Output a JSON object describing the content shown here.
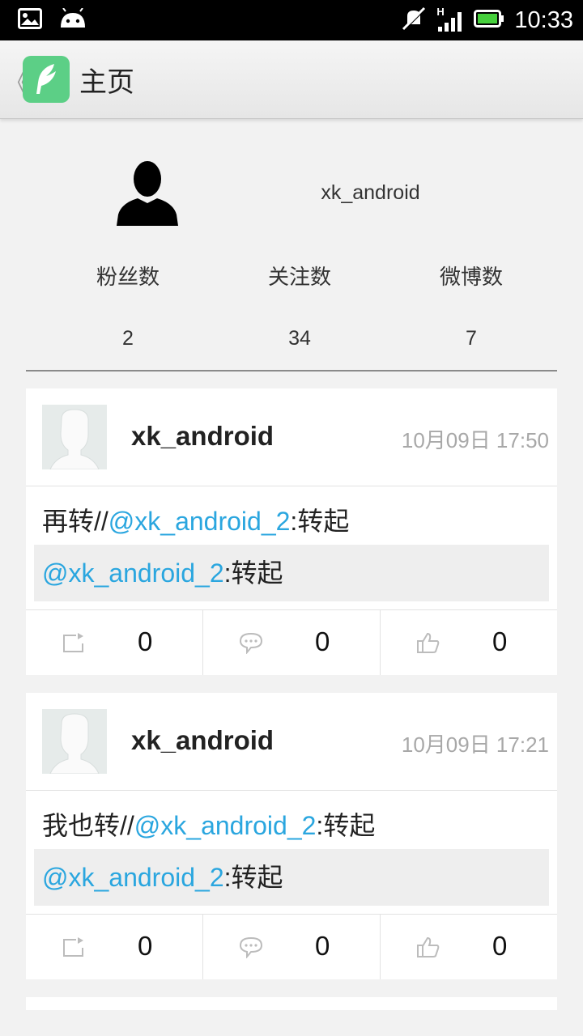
{
  "status_bar": {
    "time": "10:33",
    "signal_label": "H",
    "icons": [
      "image-icon",
      "android-icon",
      "mute-icon",
      "signal-icon",
      "battery-icon"
    ]
  },
  "action_bar": {
    "back_glyph": "《",
    "title": "主页",
    "app_icon": "feather-icon",
    "accent": "#5ccf86"
  },
  "profile": {
    "username": "xk_android",
    "stats": [
      {
        "label": "粉丝数",
        "value": "2"
      },
      {
        "label": "关注数",
        "value": "34"
      },
      {
        "label": "微博数",
        "value": "7"
      }
    ]
  },
  "posts": [
    {
      "author": "xk_android",
      "time": "10月09日 17:50",
      "text_prefix": "再转//",
      "text_mention": "@xk_android_2",
      "text_suffix": ":转起",
      "repost_mention": "@xk_android_2",
      "repost_suffix": ":转起",
      "reposts": "0",
      "comments": "0",
      "likes": "0"
    },
    {
      "author": "xk_android",
      "time": "10月09日 17:21",
      "text_prefix": "我也转//",
      "text_mention": "@xk_android_2",
      "text_suffix": ":转起",
      "repost_mention": "@xk_android_2",
      "repost_suffix": ":转起",
      "reposts": "0",
      "comments": "0",
      "likes": "0"
    }
  ],
  "colors": {
    "mention": "#2aa6df",
    "background": "#f2f2f2",
    "time_text": "#a8a8a8"
  }
}
